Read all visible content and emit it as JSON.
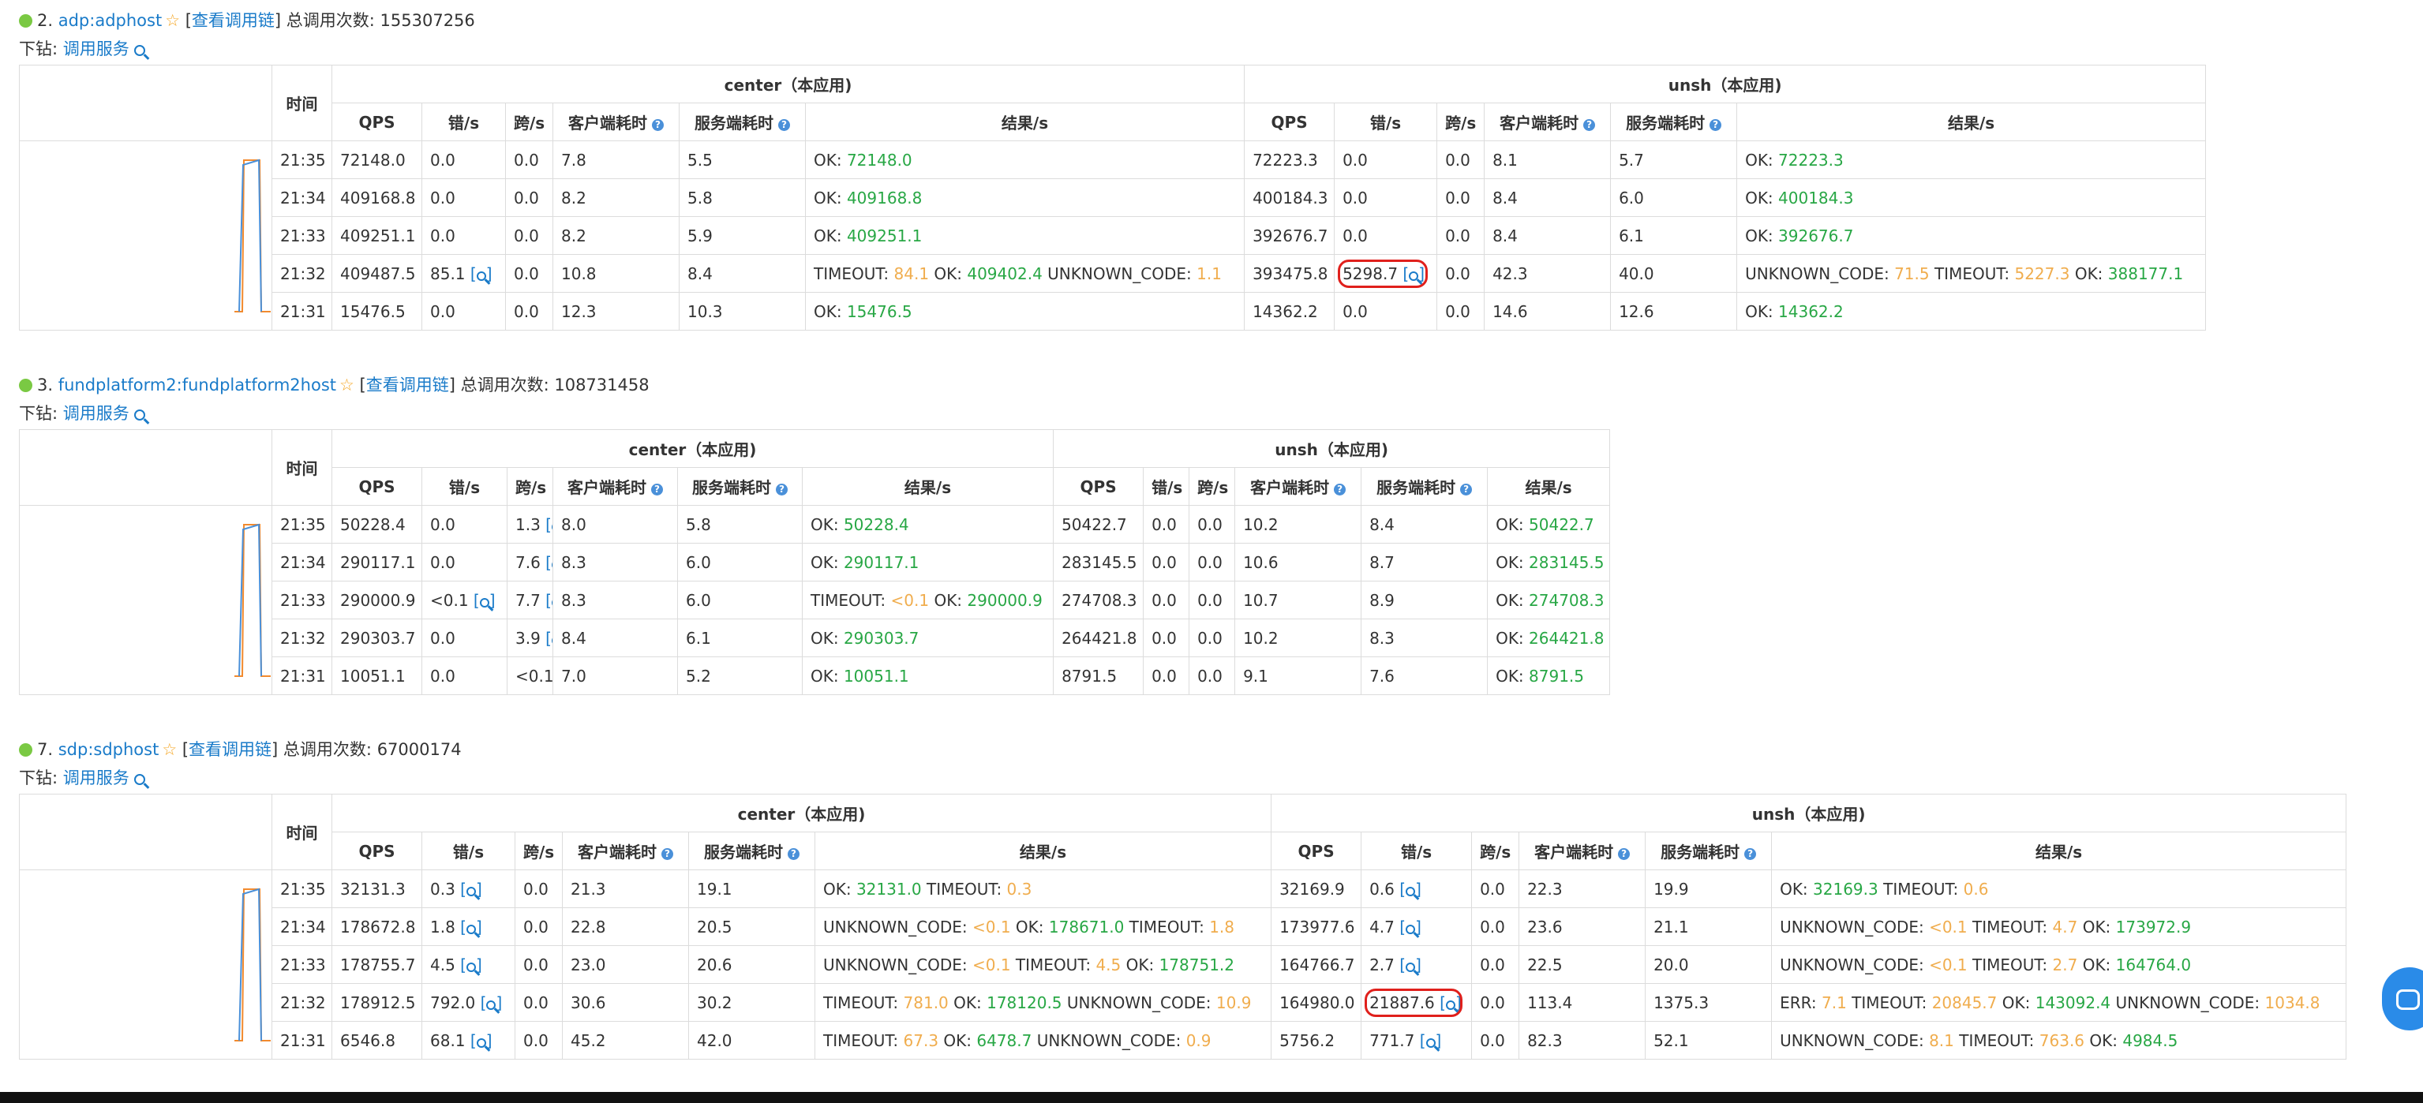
{
  "sections": [
    {
      "index": "2.",
      "app": "adp:adphost",
      "chain_link": "查看调用链",
      "total_label": "总调用次数:",
      "total": "155307256",
      "drill_label": "下钻:",
      "drill_link": "调用服务",
      "left_group": "center（本应用)",
      "right_group": "unsh（本应用)",
      "rows": [
        {
          "time": "21:35",
          "c_qps": "72148.0",
          "c_err": "0.0",
          "c_cross": "0.0",
          "c_client": "7.8",
          "c_server": "5.5",
          "c_results": [
            [
              "OK: ",
              "72148.0",
              "ok"
            ]
          ],
          "u_qps": "72223.3",
          "u_err": "0.0",
          "u_cross": "0.0",
          "u_client": "8.1",
          "u_server": "5.7",
          "u_results": [
            [
              "OK: ",
              "72223.3",
              "ok"
            ]
          ]
        },
        {
          "time": "21:34",
          "c_qps": "409168.8",
          "c_err": "0.0",
          "c_cross": "0.0",
          "c_client": "8.2",
          "c_server": "5.8",
          "c_results": [
            [
              "OK: ",
              "409168.8",
              "ok"
            ]
          ],
          "u_qps": "400184.3",
          "u_err": "0.0",
          "u_cross": "0.0",
          "u_client": "8.4",
          "u_server": "6.0",
          "u_results": [
            [
              "OK: ",
              "400184.3",
              "ok"
            ]
          ]
        },
        {
          "time": "21:33",
          "c_qps": "409251.1",
          "c_err": "0.0",
          "c_cross": "0.0",
          "c_client": "8.2",
          "c_server": "5.9",
          "c_results": [
            [
              "OK: ",
              "409251.1",
              "ok"
            ]
          ],
          "u_qps": "392676.7",
          "u_err": "0.0",
          "u_cross": "0.0",
          "u_client": "8.4",
          "u_server": "6.1",
          "u_results": [
            [
              "OK: ",
              "392676.7",
              "ok"
            ]
          ]
        },
        {
          "time": "21:32",
          "c_qps": "409487.5",
          "c_err": "85.1",
          "c_err_zoom": true,
          "c_cross": "0.0",
          "c_client": "10.8",
          "c_server": "8.4",
          "c_results": [
            [
              "TIMEOUT: ",
              "84.1",
              "warn"
            ],
            [
              "OK: ",
              "409402.4",
              "ok"
            ],
            [
              "UNKNOWN_CODE: ",
              "1.1",
              "warn"
            ]
          ],
          "u_qps": "393475.8",
          "u_err": "5298.7",
          "u_err_zoom": true,
          "u_err_circled": true,
          "u_cross": "0.0",
          "u_client": "42.3",
          "u_server": "40.0",
          "u_results": [
            [
              "UNKNOWN_CODE: ",
              "71.5",
              "warn"
            ],
            [
              "TIMEOUT: ",
              "5227.3",
              "warn"
            ],
            [
              "OK: ",
              "388177.1",
              "ok"
            ]
          ]
        },
        {
          "time": "21:31",
          "c_qps": "15476.5",
          "c_err": "0.0",
          "c_cross": "0.0",
          "c_client": "12.3",
          "c_server": "10.3",
          "c_results": [
            [
              "OK: ",
              "15476.5",
              "ok"
            ]
          ],
          "u_qps": "14362.2",
          "u_err": "0.0",
          "u_cross": "0.0",
          "u_client": "14.6",
          "u_server": "12.6",
          "u_results": [
            [
              "OK: ",
              "14362.2",
              "ok"
            ]
          ]
        }
      ]
    },
    {
      "index": "3.",
      "app": "fundplatform2:fundplatform2host",
      "chain_link": "查看调用链",
      "total_label": "总调用次数:",
      "total": "108731458",
      "drill_label": "下钻:",
      "drill_link": "调用服务",
      "left_group": "center（本应用)",
      "right_group": "unsh（本应用)",
      "rows": [
        {
          "time": "21:35",
          "c_qps": "50228.4",
          "c_err": "0.0",
          "c_cross": "1.3",
          "c_cross_zoom": true,
          "c_client": "8.0",
          "c_server": "5.8",
          "c_results": [
            [
              "OK: ",
              "50228.4",
              "ok"
            ]
          ],
          "u_qps": "50422.7",
          "u_err": "0.0",
          "u_cross": "0.0",
          "u_client": "10.2",
          "u_server": "8.4",
          "u_results": [
            [
              "OK: ",
              "50422.7",
              "ok"
            ]
          ]
        },
        {
          "time": "21:34",
          "c_qps": "290117.1",
          "c_err": "0.0",
          "c_cross": "7.6",
          "c_cross_zoom": true,
          "c_client": "8.3",
          "c_server": "6.0",
          "c_results": [
            [
              "OK: ",
              "290117.1",
              "ok"
            ]
          ],
          "u_qps": "283145.5",
          "u_err": "0.0",
          "u_cross": "0.0",
          "u_client": "10.6",
          "u_server": "8.7",
          "u_results": [
            [
              "OK: ",
              "283145.5",
              "ok"
            ]
          ]
        },
        {
          "time": "21:33",
          "c_qps": "290000.9",
          "c_err": "<0.1",
          "c_err_zoom": true,
          "c_cross": "7.7",
          "c_cross_zoom": true,
          "c_client": "8.3",
          "c_server": "6.0",
          "c_results": [
            [
              "TIMEOUT: ",
              "<0.1",
              "warn"
            ],
            [
              "OK: ",
              "290000.9",
              "ok"
            ]
          ],
          "u_qps": "274708.3",
          "u_err": "0.0",
          "u_cross": "0.0",
          "u_client": "10.7",
          "u_server": "8.9",
          "u_results": [
            [
              "OK: ",
              "274708.3",
              "ok"
            ]
          ]
        },
        {
          "time": "21:32",
          "c_qps": "290303.7",
          "c_err": "0.0",
          "c_cross": "3.9",
          "c_cross_zoom": true,
          "c_client": "8.4",
          "c_server": "6.1",
          "c_results": [
            [
              "OK: ",
              "290303.7",
              "ok"
            ]
          ],
          "u_qps": "264421.8",
          "u_err": "0.0",
          "u_cross": "0.0",
          "u_client": "10.2",
          "u_server": "8.3",
          "u_results": [
            [
              "OK: ",
              "264421.8",
              "ok"
            ]
          ]
        },
        {
          "time": "21:31",
          "c_qps": "10051.1",
          "c_err": "0.0",
          "c_cross": "<0.1",
          "c_cross_zoom": true,
          "c_client": "7.0",
          "c_server": "5.2",
          "c_results": [
            [
              "OK: ",
              "10051.1",
              "ok"
            ]
          ],
          "u_qps": "8791.5",
          "u_err": "0.0",
          "u_cross": "0.0",
          "u_client": "9.1",
          "u_server": "7.6",
          "u_results": [
            [
              "OK: ",
              "8791.5",
              "ok"
            ]
          ]
        }
      ]
    },
    {
      "index": "7.",
      "app": "sdp:sdphost",
      "chain_link": "查看调用链",
      "total_label": "总调用次数:",
      "total": "67000174",
      "drill_label": "下钻:",
      "drill_link": "调用服务",
      "left_group": "center（本应用)",
      "right_group": "unsh（本应用)",
      "rows": [
        {
          "time": "21:35",
          "c_qps": "32131.3",
          "c_err": "0.3",
          "c_err_zoom": true,
          "c_cross": "0.0",
          "c_client": "21.3",
          "c_server": "19.1",
          "c_results": [
            [
              "OK: ",
              "32131.0",
              "ok"
            ],
            [
              "TIMEOUT: ",
              "0.3",
              "warn"
            ]
          ],
          "u_qps": "32169.9",
          "u_err": "0.6",
          "u_err_zoom": true,
          "u_cross": "0.0",
          "u_client": "22.3",
          "u_server": "19.9",
          "u_results": [
            [
              "OK: ",
              "32169.3",
              "ok"
            ],
            [
              "TIMEOUT: ",
              "0.6",
              "warn"
            ]
          ]
        },
        {
          "time": "21:34",
          "c_qps": "178672.8",
          "c_err": "1.8",
          "c_err_zoom": true,
          "c_cross": "0.0",
          "c_client": "22.8",
          "c_server": "20.5",
          "c_results": [
            [
              "UNKNOWN_CODE: ",
              "<0.1",
              "warn"
            ],
            [
              "OK: ",
              "178671.0",
              "ok"
            ],
            [
              "TIMEOUT: ",
              "1.8",
              "warn"
            ]
          ],
          "u_qps": "173977.6",
          "u_err": "4.7",
          "u_err_zoom": true,
          "u_cross": "0.0",
          "u_client": "23.6",
          "u_server": "21.1",
          "u_results": [
            [
              "UNKNOWN_CODE: ",
              "<0.1",
              "warn"
            ],
            [
              "TIMEOUT: ",
              "4.7",
              "warn"
            ],
            [
              "OK: ",
              "173972.9",
              "ok"
            ]
          ]
        },
        {
          "time": "21:33",
          "c_qps": "178755.7",
          "c_err": "4.5",
          "c_err_zoom": true,
          "c_cross": "0.0",
          "c_client": "23.0",
          "c_server": "20.6",
          "c_results": [
            [
              "UNKNOWN_CODE: ",
              "<0.1",
              "warn"
            ],
            [
              "TIMEOUT: ",
              "4.5",
              "warn"
            ],
            [
              "OK: ",
              "178751.2",
              "ok"
            ]
          ],
          "u_qps": "164766.7",
          "u_err": "2.7",
          "u_err_zoom": true,
          "u_cross": "0.0",
          "u_client": "22.5",
          "u_server": "20.0",
          "u_results": [
            [
              "UNKNOWN_CODE: ",
              "<0.1",
              "warn"
            ],
            [
              "TIMEOUT: ",
              "2.7",
              "warn"
            ],
            [
              "OK: ",
              "164764.0",
              "ok"
            ]
          ]
        },
        {
          "time": "21:32",
          "c_qps": "178912.5",
          "c_err": "792.0",
          "c_err_zoom": true,
          "c_cross": "0.0",
          "c_client": "30.6",
          "c_server": "30.2",
          "c_results": [
            [
              "TIMEOUT: ",
              "781.0",
              "warn"
            ],
            [
              "OK: ",
              "178120.5",
              "ok"
            ],
            [
              "UNKNOWN_CODE: ",
              "10.9",
              "warn"
            ]
          ],
          "u_qps": "164980.0",
          "u_err": "21887.6",
          "u_err_zoom": true,
          "u_err_circled": true,
          "u_cross": "0.0",
          "u_client": "113.4",
          "u_server": "1375.3",
          "u_results": [
            [
              "ERR: ",
              "7.1",
              "warn"
            ],
            [
              "TIMEOUT: ",
              "20845.7",
              "warn"
            ],
            [
              "OK: ",
              "143092.4",
              "ok"
            ],
            [
              "UNKNOWN_CODE: ",
              "1034.8",
              "warn"
            ]
          ]
        },
        {
          "time": "21:31",
          "c_qps": "6546.8",
          "c_err": "68.1",
          "c_err_zoom": true,
          "c_cross": "0.0",
          "c_client": "45.2",
          "c_server": "42.0",
          "c_results": [
            [
              "TIMEOUT: ",
              "67.3",
              "warn"
            ],
            [
              "OK: ",
              "6478.7",
              "ok"
            ],
            [
              "UNKNOWN_CODE: ",
              "0.9",
              "warn"
            ]
          ],
          "u_qps": "5756.2",
          "u_err": "771.7",
          "u_err_zoom": true,
          "u_cross": "0.0",
          "u_client": "82.3",
          "u_server": "52.1",
          "u_results": [
            [
              "UNKNOWN_CODE: ",
              "8.1",
              "warn"
            ],
            [
              "TIMEOUT: ",
              "763.6",
              "warn"
            ],
            [
              "OK: ",
              "4984.5",
              "ok"
            ]
          ]
        }
      ]
    }
  ],
  "columns": {
    "time": "时间",
    "qps": "QPS",
    "err": "错/s",
    "cross": "跨/s",
    "client": "客户端耗时",
    "server": "服务端耗时",
    "results": "结果/s"
  },
  "help_icon": "help-circle-icon",
  "zoom_text": "[🔍]",
  "colors": {
    "ok": "#28a745",
    "warn": "#f0ad4e",
    "link": "#1a7bc9",
    "highlight": "#e0201c",
    "status_dot": "#7ac943"
  }
}
